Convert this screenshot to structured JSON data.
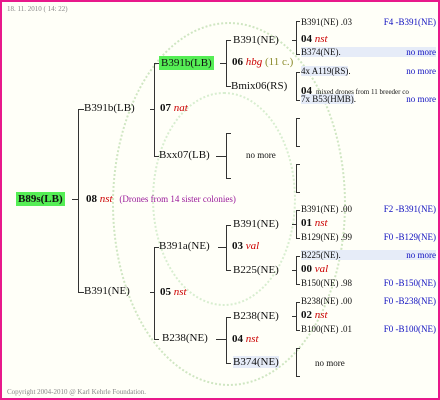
{
  "header": {
    "date": "18. 11. 2010 ( 14: 22)"
  },
  "footer": {
    "copyright": "Copyright 2004-2010 @ Karl Kehrle Foundation."
  },
  "root": {
    "id": "B89s(LB)",
    "year": "08",
    "race": "nst",
    "note": "(Drones from 14 sister colonies)"
  },
  "gen1": {
    "top": {
      "id": "B391b(LB)",
      "year": "07",
      "race": "nat"
    },
    "bottom": {
      "id": "B391(NE)",
      "year": "05",
      "race": "nst"
    }
  },
  "gen2": {
    "a": {
      "id": "B391b(LB)",
      "year": "06",
      "race": "hbg",
      "extra": "(11 c.)"
    },
    "b": {
      "id": "Bxx07(LB)",
      "nomore": "no more"
    },
    "c": {
      "id": "B391a(NE)",
      "year": "03",
      "race": "val"
    },
    "d": {
      "id": "B238(NE)",
      "year": "04",
      "race": "nst"
    }
  },
  "gen3": {
    "a1": {
      "id": "B391(NE)",
      "year": "04",
      "race": "nst"
    },
    "a2": {
      "id": "Bmix06(RS)",
      "year": "04",
      "desc": "mixed drones from 11 breeder co"
    },
    "c1": {
      "id": "B391(NE)",
      "year": "01",
      "race": "nst"
    },
    "c2": {
      "id": "B225(NE)",
      "year": "00",
      "race": "val"
    },
    "d1": {
      "id": "B238(NE)",
      "year": "02",
      "race": "nst"
    },
    "d2": {
      "id": "B374(NE)",
      "nomore": "no more"
    }
  },
  "gen4": [
    {
      "id": "B391(NE)",
      "year": ".03",
      "ref": "F4 -B391(NE)"
    },
    {
      "id": "B374(NE)",
      "year": ".",
      "ref": "no more"
    },
    {
      "id": "4x A119(RS)",
      "year": ".",
      "ref": "no more"
    },
    {
      "id": "7x B53(HMB)",
      "year": ".",
      "ref": "no more"
    },
    {
      "id": "B391(NE)",
      "year": ".00",
      "ref": "F2 -B391(NE)"
    },
    {
      "id": "B129(NE)",
      "year": ".99",
      "ref": "F0 -B129(NE)"
    },
    {
      "id": "B225(NE)",
      "year": ".",
      "ref": "no more"
    },
    {
      "id": "B150(NE)",
      "year": ".98",
      "ref": "F0 -B150(NE)"
    },
    {
      "id": "B238(NE)",
      "year": ".00",
      "ref": "F0 -B238(NE)"
    },
    {
      "id": "B100(NE)",
      "year": ".01",
      "ref": "F0 -B100(NE)"
    }
  ]
}
